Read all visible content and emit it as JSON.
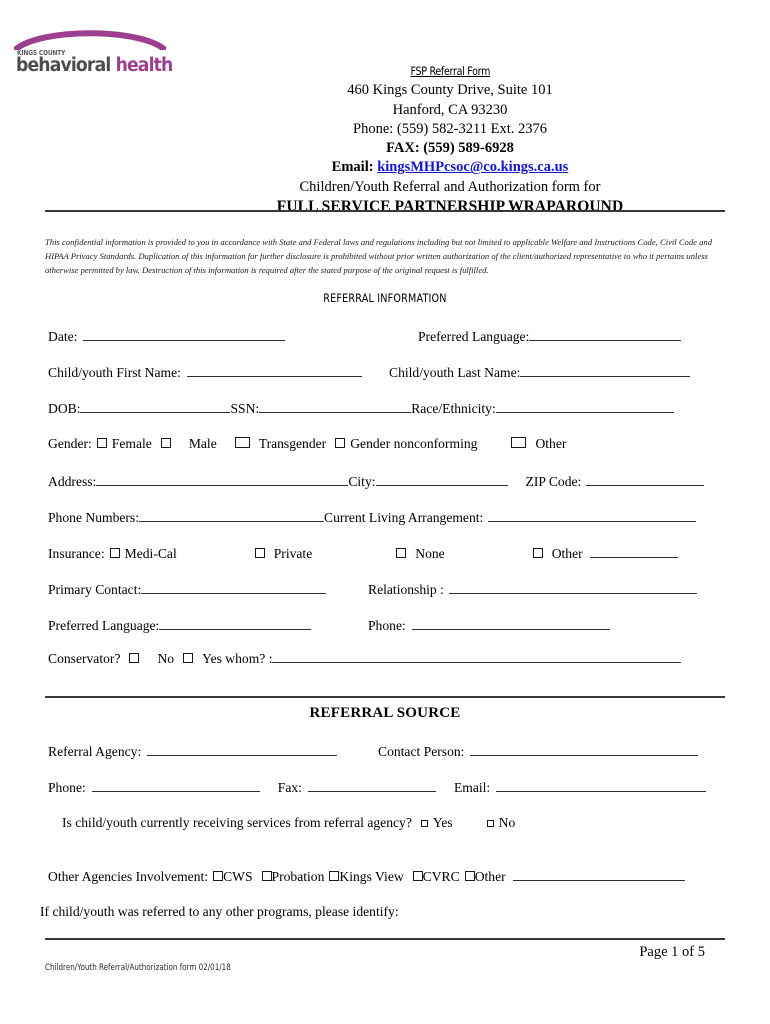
{
  "logo": {
    "kings_county": "KINGS COUNTY",
    "word_dark": "behavioral",
    "word_accent": "health",
    "arc_color": "#9c3f8f",
    "dark_color": "#4d4d4d"
  },
  "header": {
    "title": "FSP Referral Form",
    "address": "460 Kings County Drive, Suite 101",
    "city_state_zip": "Hanford, CA 93230",
    "phone": "Phone: (559) 582-3211 Ext. 2376",
    "fax": "FAX: (559) 589-6928",
    "email_label": "Email:",
    "email_address": "kingsMHPcsoc@co.kings.ca.us",
    "email_color": "#1414cc",
    "form_for": "Children/Youth Referral and Authorization form for",
    "program": "FULL SERVICE PARTNERSHIP WRAPAROUND"
  },
  "confidentiality_notice": "This confidential information is provided to you in accordance with State and Federal laws and regulations including but not limited to applicable    Welfare and Instructions Code, Civil Code and HIPAA Privacy Standards. Duplication of this information for further disclosure is prohibited    without prior written authorization of the client/authorized representative to who it pertains unless otherwise permitted by law. Destruction of this    information is required after the stated purpose of the original request is fulfilled.",
  "referral_information": {
    "heading": "REFERRAL INFORMATION",
    "date_label": "Date:",
    "preferred_language_label": "Preferred Language:",
    "first_name_label": "Child/youth First Name:",
    "last_name_label": "Child/youth Last Name:",
    "dob_label": "DOB:",
    "ssn_label": "SSN:",
    "race_ethnicity_label": "Race/Ethnicity:",
    "gender_label": "Gender:",
    "gender_options": [
      "Female",
      "Male",
      "Transgender",
      "Gender nonconforming",
      "Other"
    ],
    "address_label": "Address:",
    "city_label": "City:",
    "zip_label": "ZIP Code:",
    "phone_numbers_label": "Phone Numbers:",
    "living_arrangement_label": "Current Living Arrangement:",
    "insurance_label": "Insurance:",
    "insurance_options": [
      "Medi-Cal",
      "Private",
      "None",
      "Other"
    ],
    "primary_contact_label": "Primary Contact:",
    "relationship_label": "Relationship :",
    "preferred_language2_label": "Preferred Language:",
    "phone2_label": "Phone:",
    "conservator_label": "Conservator?",
    "conservator_no": "No",
    "conservator_yes": "Yes whom? :"
  },
  "referral_source": {
    "heading": "REFERRAL SOURCE",
    "agency_label": "Referral Agency:",
    "contact_person_label": "Contact Person:",
    "phone_label": "Phone:",
    "fax_label": "Fax:",
    "email_label": "Email:",
    "currently_receiving_question": "Is child/youth currently receiving services from referral agency?",
    "yes_label": "Yes",
    "no_label": "No",
    "other_agencies_label": "Other Agencies Involvement:",
    "other_agencies_options": [
      "CWS",
      "Probation",
      "Kings View",
      "CVRC",
      "Other"
    ],
    "other_programs_question": "If child/youth was referred to any other programs, please identify:"
  },
  "footer": {
    "page_number": "Page 1 of 5",
    "form_note": "Children/Youth Referral/Authorization form 02/01/18"
  }
}
